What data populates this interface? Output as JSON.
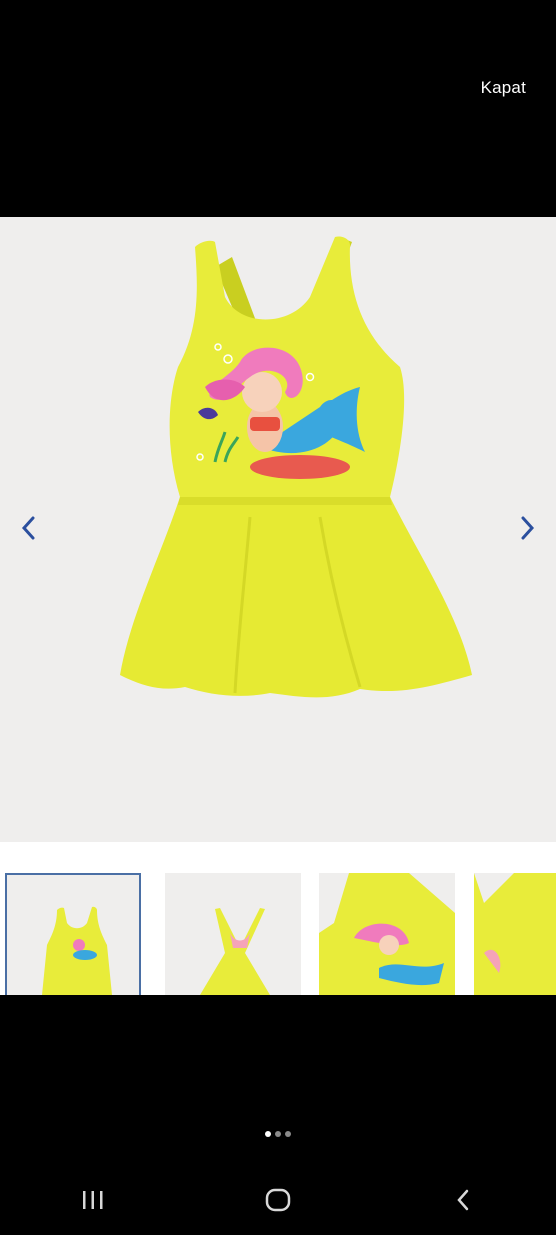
{
  "header": {
    "close_label": "Kapat"
  },
  "gallery": {
    "prev_icon": "chevron-left-icon",
    "next_icon": "chevron-right-icon",
    "thumbnail_count": 4,
    "active_index": 0
  },
  "pager": {
    "total": 3,
    "active": 0
  },
  "system_nav": {
    "recents_icon": "recents-icon",
    "home_icon": "home-icon",
    "back_icon": "back-icon"
  },
  "colors": {
    "swimsuit_yellow": "#e8ec3a",
    "viewer_bg": "#efeeed",
    "arrow_blue": "#2b4f9e",
    "mermaid_hair_pink": "#f07bbd",
    "mermaid_tail_blue": "#3aa7de"
  }
}
